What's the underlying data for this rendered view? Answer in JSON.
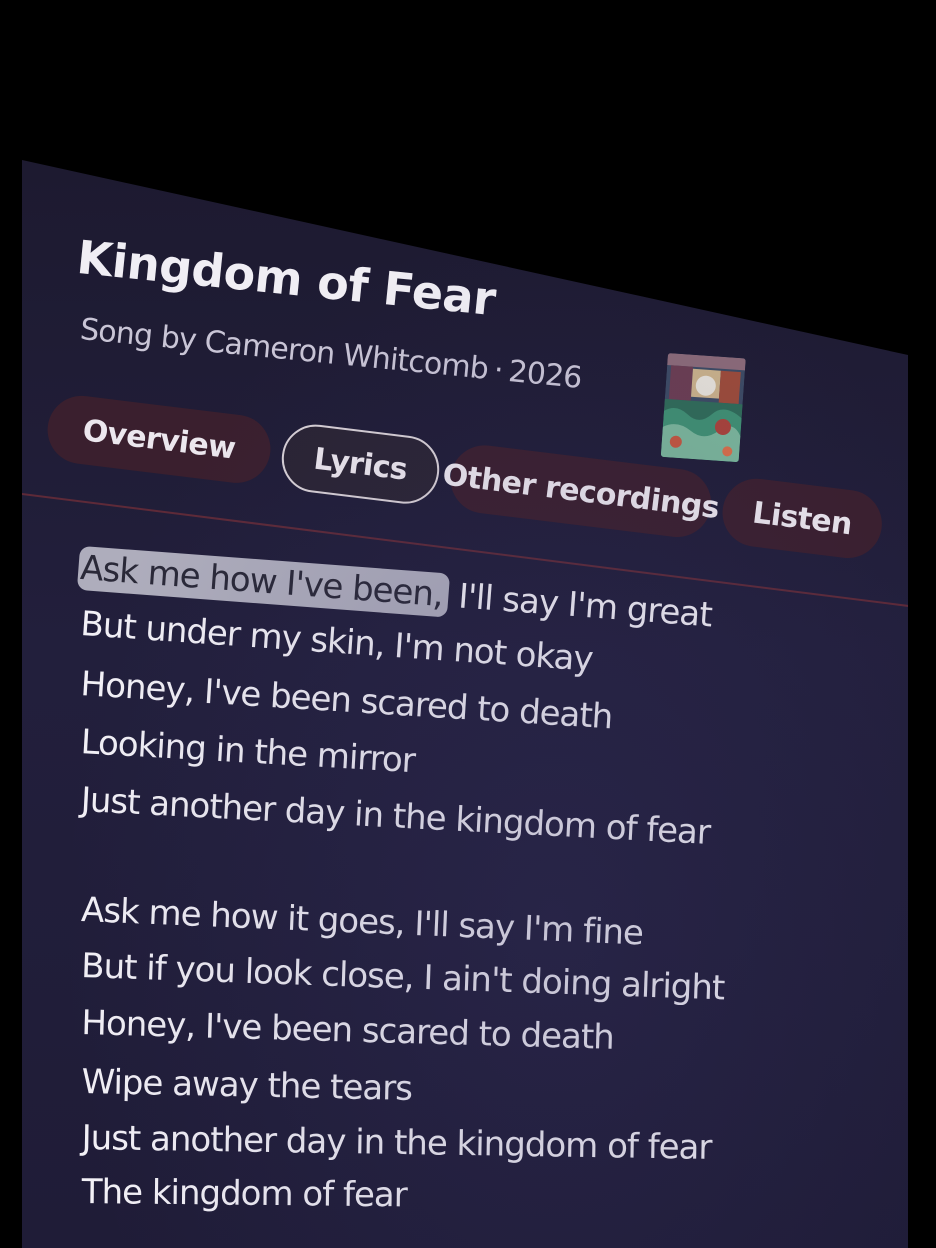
{
  "song": {
    "title": "Kingdom of Fear",
    "type_label": "Song by",
    "artist": "Cameron Whitcomb",
    "separator": "·",
    "year": "2026"
  },
  "tabs": [
    {
      "label": "Overview",
      "active": false
    },
    {
      "label": "Lyrics",
      "active": true
    },
    {
      "label": "Other recordings",
      "active": false
    },
    {
      "label": "Listen",
      "active": false
    }
  ],
  "lyrics": {
    "line1_highlight": "Ask me how I've been,",
    "line1_rest": " I'll say I'm great",
    "lines": [
      "But under my skin, I'm not okay",
      "Honey, I've been scared to death",
      "Looking in the mirror",
      "Just another day in the kingdom of fear",
      "Ask me how it goes, I'll say I'm fine",
      "But if you look close, I ain't doing alright",
      "Honey, I've been scared to death",
      "Wipe away the tears",
      "Just another day in the kingdom of fear",
      "The kingdom of fear"
    ]
  },
  "colors": {
    "background": "#1d1a30",
    "tab_background": "#3a1f2e",
    "highlight": "#aeadbc",
    "divider": "#5e2a38"
  }
}
